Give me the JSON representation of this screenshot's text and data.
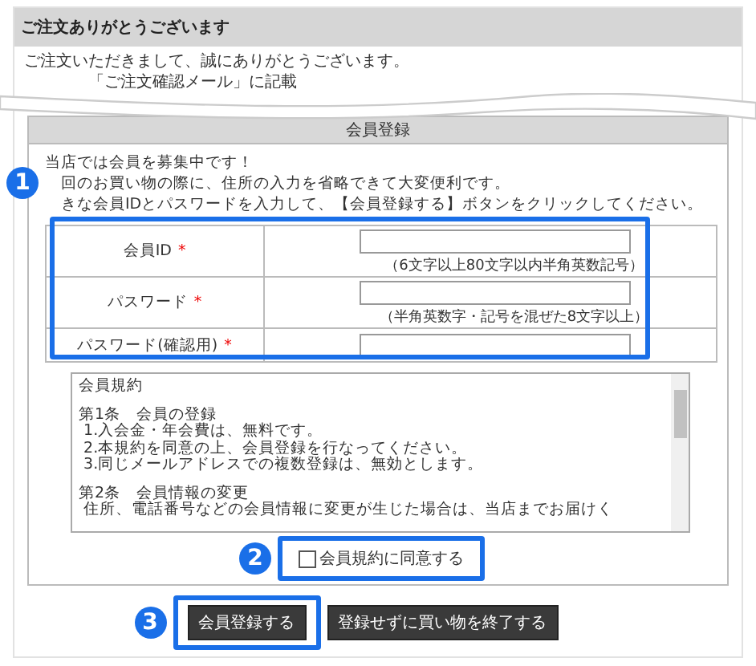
{
  "header": {
    "title": "ご注文ありがとうございます"
  },
  "thanks_lines": [
    "ご注文いただきまして、誠にありがとうございます。",
    "「ご注文確認メール」に記載"
  ],
  "registration": {
    "title": "会員登録",
    "intro": [
      "当店では会員を募集中です！",
      "回のお買い物の際に、住所の入力を省略できて大変便利です。",
      "きな会員IDとパスワードを入力して、【会員登録する】ボタンをクリックしてください。"
    ],
    "fields": [
      {
        "label": "会員ID",
        "required_mark": "*",
        "hint": "（6文字以上80文字以内半角英数記号）"
      },
      {
        "label": "パスワード",
        "required_mark": "*",
        "hint": "（半角英数字・記号を混ぜた8文字以上）"
      },
      {
        "label": "パスワード(確認用)",
        "required_mark": "*"
      }
    ],
    "terms": {
      "paragraphs": [
        [
          "会員規約"
        ],
        [
          "第1条　会員の登録",
          " 1.入会金・年会費は、無料です。",
          " 2.本規約を同意の上、会員登録を行なってください。",
          " 3.同じメールアドレスでの複数登録は、無効とします。"
        ],
        [
          "第2条　会員情報の変更",
          " 住所、電話番号などの会員情報に変更が生じた場合は、当店までお届けく"
        ]
      ]
    },
    "agree": {
      "label": "会員規約に同意する",
      "checked": false
    },
    "buttons": [
      {
        "label": "会員登録する"
      },
      {
        "label": "登録せずに買い物を終了する"
      }
    ]
  },
  "annotations": [
    {
      "number": "1"
    },
    {
      "number": "2"
    },
    {
      "number": "3"
    }
  ]
}
